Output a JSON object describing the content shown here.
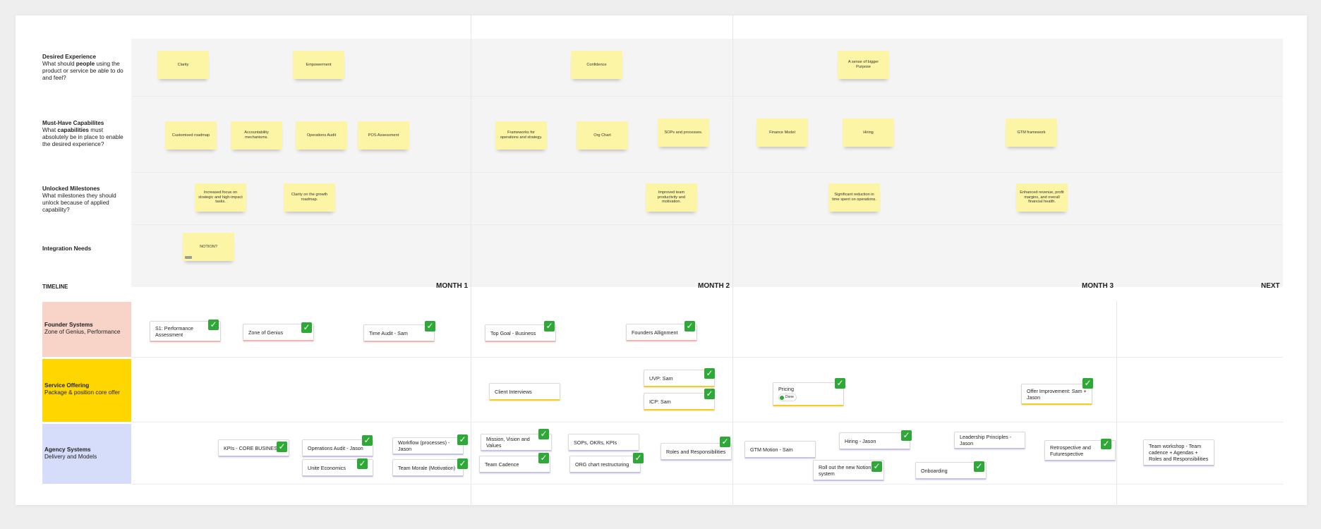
{
  "rows": {
    "desired": {
      "title": "Desired Experience",
      "pre": "What should ",
      "bold": "people",
      "post": " using the product or service be able to do and feel?"
    },
    "capabilities": {
      "title": "Must-Have Capabilites",
      "pre": "What ",
      "bold": "capabilities",
      "post": " must absolutely be in place to enable the desired experience?"
    },
    "milestones": {
      "title": "Unlocked Milestones",
      "text": "What milestones they should unlock because of applied capability?"
    },
    "integration": {
      "title": "Integration Needs"
    }
  },
  "stickies": {
    "desired": [
      "Clarity",
      "Empowerment",
      "Confidence",
      "A sense of bigger Purpose"
    ],
    "capabilities": [
      "Customised roadmap",
      "Accountability mechanisms.",
      "Operations Audit",
      "POS Assessment",
      "Frameworks for operations and strategy.",
      "Org Chart",
      "SOPs and processes.",
      "Finance Model",
      "Hiring",
      "GTM framework"
    ],
    "milestones": [
      "Increased focus on strategic and high-impact tasks.",
      "Clarity on the growth roadmap.",
      "Improved team productivity and motivation.",
      "Significant reduction in time spent on operations.",
      "Enhanced revenue, profit margins, and overall financial health."
    ],
    "integration": [
      "NOTION?"
    ]
  },
  "timeline": {
    "label": "TIMELINE",
    "months": [
      "MONTH 1",
      "MONTH 2",
      "MONTH 3",
      "NEXT"
    ]
  },
  "swimlanes": {
    "founder": {
      "title": "Founder Systems",
      "subtitle": "Zone of Genius, Performance",
      "color": "#f7d3c8"
    },
    "service": {
      "title": "Service Offering",
      "subtitle": "Package & position core offer",
      "color": "#ffd600"
    },
    "agency": {
      "title": "Agency Systems",
      "subtitle": "Delivery and Models",
      "color": "#d6ddfb"
    }
  },
  "cards": {
    "founder": [
      "S1: Performance Assessment",
      "Zone of Genius",
      "Time Audit - Sam",
      "Top Goal - Business",
      "Founders Allignment"
    ],
    "service": [
      "Client Interviews",
      "UVP: Sam",
      "ICP: Sam",
      "Pricing",
      "Offer Improvement: Sam + Jason"
    ],
    "service_tag": "Done",
    "agency": [
      "KPIs - CORE BUSINESS",
      "Operations Audit - Jason",
      "Unite Economics",
      "Workflow (processes) - Jason",
      "Team Morale (Motivation)",
      "Mission, Vision and Values",
      "Team Cadence",
      "SOPs, OKRs, KPIs",
      "ORG chart restructuring",
      "Roles and Responsibilities",
      "GTM Motion - Sam",
      "Hiring - Jason",
      "Roll out the new Notion system",
      "Leadership Principles - Jason",
      "Onboarding",
      "Retrospective and Futurespective",
      "Team workshop - Team cadence + Agendas + Roles and Responsibilities"
    ]
  },
  "check_icon": "check-mark-icon",
  "check_glyph": "✓",
  "colors": {
    "sticky": "#fdf5a6",
    "check": "#2ea836"
  }
}
